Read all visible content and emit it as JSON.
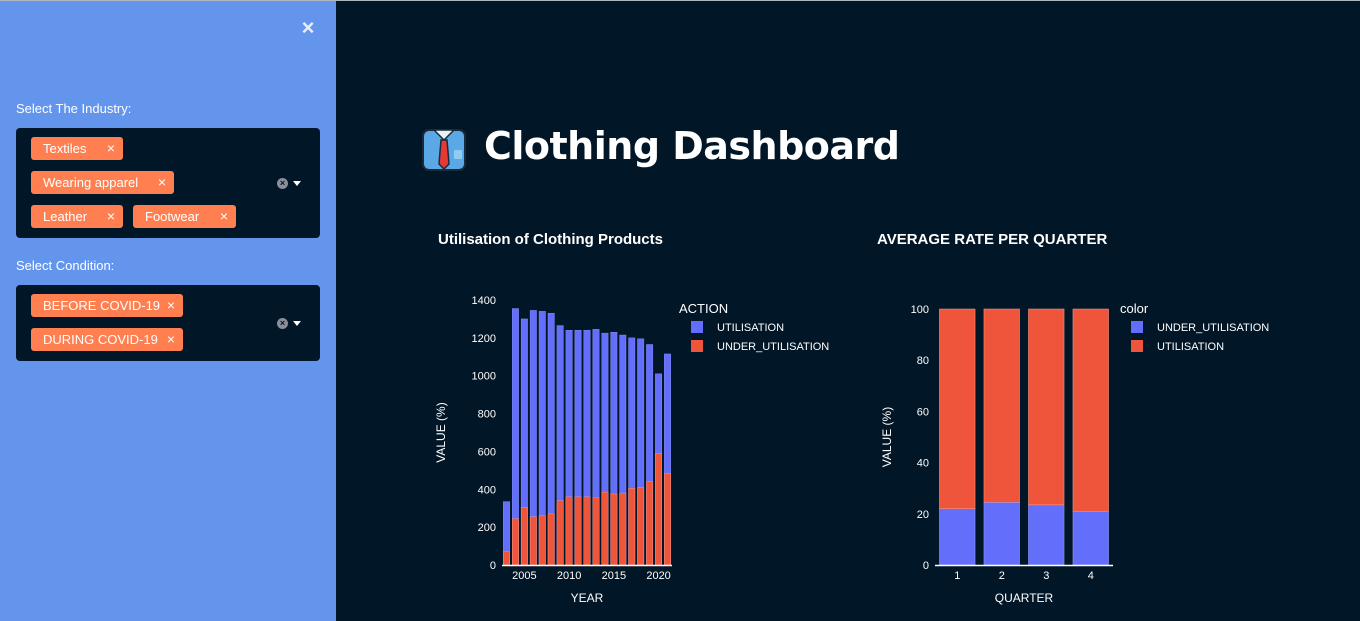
{
  "sidebar": {
    "close_label": "×",
    "industry_label": "Select The Industry:",
    "industry_tags": [
      "Textiles",
      "Wearing apparel",
      "Leather",
      "Footwear"
    ],
    "condition_label": "Select Condition:",
    "condition_tags": [
      "BEFORE COVID-19",
      "DURING COVID-19"
    ],
    "tag_remove": "×"
  },
  "main": {
    "title": "Clothing Dashboard",
    "title_icon": "shirt-tie-icon"
  },
  "colors": {
    "utilisation": "#636efa",
    "under_utilisation": "#ef553b",
    "sidebar": "#6495ed",
    "tag": "#ff7f50",
    "background": "#011627"
  },
  "chart_data": [
    {
      "type": "bar",
      "title": "Utilisation of Clothing Products",
      "xlabel": "YEAR",
      "ylabel": "VALUE (%)",
      "ylim": [
        0,
        1400
      ],
      "yticks": [
        "0",
        "200",
        "400",
        "600",
        "800",
        "1000",
        "1200",
        "1400"
      ],
      "xticks": [
        "2005",
        "2010",
        "2015",
        "2020"
      ],
      "legend_title": "ACTION",
      "categories": [
        2003,
        2004,
        2005,
        2006,
        2007,
        2008,
        2009,
        2010,
        2011,
        2012,
        2013,
        2014,
        2015,
        2016,
        2017,
        2018,
        2019,
        2020,
        2021
      ],
      "series": [
        {
          "name": "UTILISATION",
          "values": [
            335,
            1355,
            1300,
            1345,
            1340,
            1330,
            1265,
            1240,
            1240,
            1240,
            1245,
            1225,
            1230,
            1215,
            1200,
            1195,
            1165,
            1010,
            1115
          ]
        },
        {
          "name": "UNDER_UTILISATION",
          "values": [
            70,
            245,
            305,
            255,
            260,
            270,
            340,
            360,
            360,
            360,
            355,
            385,
            375,
            380,
            405,
            410,
            440,
            590,
            485
          ]
        }
      ]
    },
    {
      "type": "bar",
      "title": "AVERAGE RATE PER QUARTER",
      "xlabel": "QUARTER",
      "ylabel": "VALUE (%)",
      "ylim": [
        0,
        100
      ],
      "yticks": [
        "0",
        "20",
        "40",
        "60",
        "80",
        "100"
      ],
      "legend_title": "color",
      "categories": [
        "1",
        "2",
        "3",
        "4"
      ],
      "stacked": true,
      "series": [
        {
          "name": "UNDER_UTILISATION",
          "values": [
            22,
            24.5,
            23.5,
            21
          ]
        },
        {
          "name": "UTILISATION",
          "values": [
            78,
            75.5,
            76.5,
            79
          ]
        }
      ]
    }
  ]
}
